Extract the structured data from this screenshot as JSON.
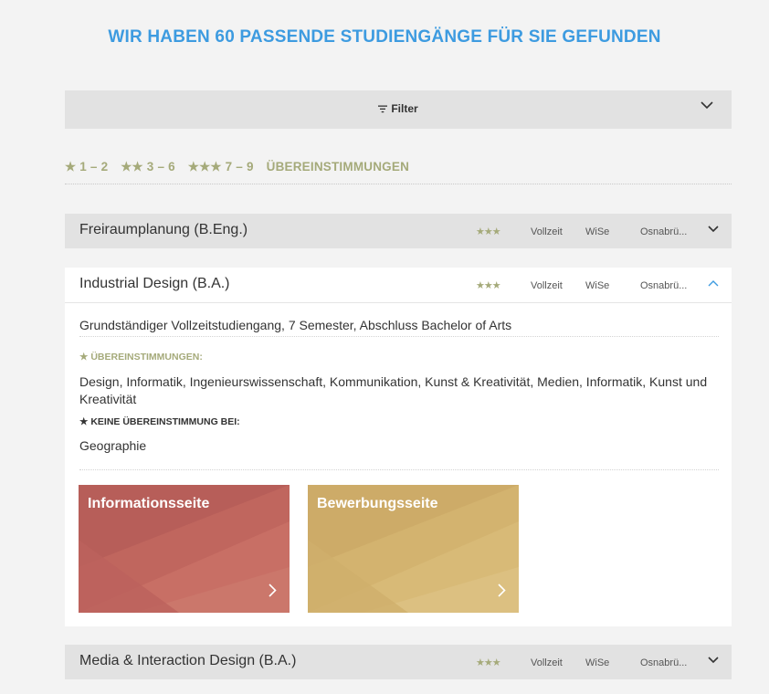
{
  "headline": "WIR HABEN 60 PASSENDE STUDIENGÄNGE FÜR SIE GEFUNDEN",
  "filter": {
    "label": "Filter"
  },
  "legend": {
    "range1": "★ 1 – 2",
    "range2": "★★ 3 – 6",
    "range3": "★★★ 7 – 9",
    "label": "ÜBEREINSTIMMUNGEN"
  },
  "courses": [
    {
      "title": "Freiraumplanung (B.Eng.)",
      "stars": "★★★",
      "mode": "Vollzeit",
      "semester": "WiSe",
      "location": "Osnabrü..."
    },
    {
      "title": "Industrial Design (B.A.)",
      "stars": "★★★",
      "mode": "Vollzeit",
      "semester": "WiSe",
      "location": "Osnabrü..."
    },
    {
      "title": "Media & Interaction Design (B.A.)",
      "stars": "★★★",
      "mode": "Vollzeit",
      "semester": "WiSe",
      "location": "Osnabrü..."
    }
  ],
  "detail": {
    "description": "Grundständiger Vollzeitstudiengang, 7 Semester, Abschluss Bachelor of Arts",
    "matches_heading": "★ ÜBEREINSTIMMUNGEN:",
    "matches_text": "Design, Informatik, Ingenieurswissenschaft, Kommunikation, Kunst & Kreativität, Medien, Informatik, Kunst und Kreativität",
    "no_match_heading": "★ KEINE ÜBEREINSTIMMUNG BEI:",
    "no_match_text": "Geographie",
    "tiles": [
      {
        "label": "Informationsseite",
        "color": "#c0665e"
      },
      {
        "label": "Bewerbungsseite",
        "color": "#d3b36f"
      }
    ]
  },
  "colors": {
    "accent_blue": "#3d9be0",
    "star_olive": "#a5aa7a"
  }
}
